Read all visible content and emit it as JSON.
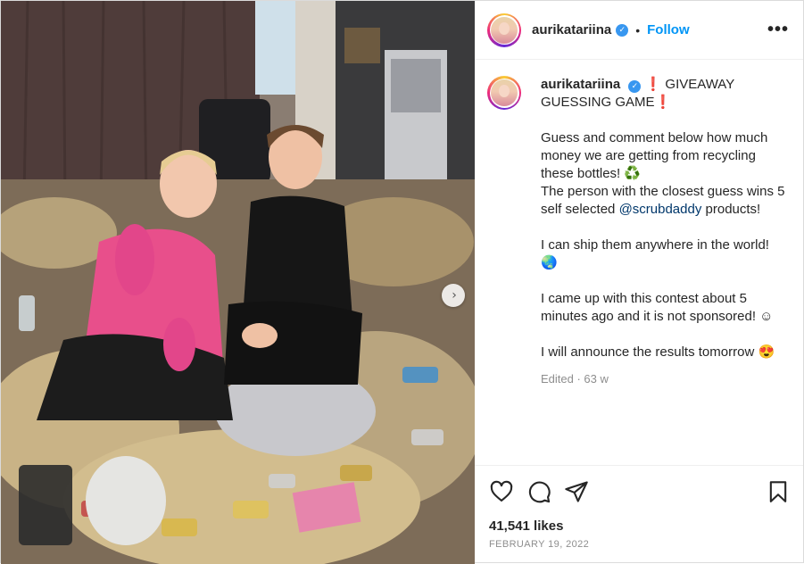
{
  "header": {
    "username": "aurikatariina",
    "verified_mark": "✓",
    "separator": "•",
    "follow_label": "Follow",
    "more_label": "•••"
  },
  "caption": {
    "username": "aurikatariina",
    "line1": "❗ GIVEAWAY GUESSING GAME❗",
    "line2a": "Guess and comment below how much money we are getting from recycling these bottles! ♻️",
    "line2b": "The person with the closest guess wins 5 self selected",
    "mention": "@scrubdaddy",
    "line2c": "products!",
    "line3": "I can ship them anywhere in the world! 🌏",
    "line4": "I came up with this contest about 5 minutes ago and it is not sponsored! ☺",
    "line5": "I will announce the results tomorrow 😍",
    "edited": "Edited · 63 w"
  },
  "actions": {
    "like_icon": "heart-icon",
    "comment_icon": "comment-icon",
    "share_icon": "share-icon",
    "save_icon": "bookmark-icon"
  },
  "likes": "41,541 likes",
  "date": "FEBRUARY 19, 2022",
  "media": {
    "next_label": "›",
    "alt": "Two women kneeling among a large pile of recycled cans and bottles"
  },
  "colors": {
    "accent": "#0095f6",
    "verified": "#3897f0",
    "mention": "#00376b",
    "muted": "#8e8e8e"
  }
}
